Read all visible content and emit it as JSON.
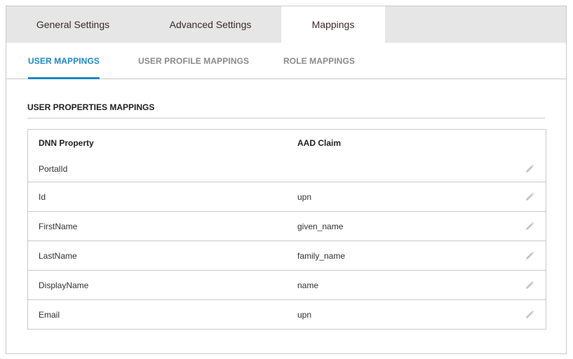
{
  "top_tabs": [
    {
      "label": "General Settings",
      "active": false
    },
    {
      "label": "Advanced Settings",
      "active": false
    },
    {
      "label": "Mappings",
      "active": true
    }
  ],
  "sub_tabs": [
    {
      "label": "USER MAPPINGS",
      "active": true
    },
    {
      "label": "USER PROFILE MAPPINGS",
      "active": false
    },
    {
      "label": "ROLE MAPPINGS",
      "active": false
    }
  ],
  "section": {
    "title": "USER PROPERTIES MAPPINGS"
  },
  "table": {
    "headers": {
      "property": "DNN Property",
      "claim": "AAD Claim"
    },
    "rows": [
      {
        "property": "PortalId",
        "claim": "",
        "action_icon": "pencil-icon"
      },
      {
        "property": "Id",
        "claim": "upn",
        "action_icon": "pencil-icon"
      },
      {
        "property": "FirstName",
        "claim": "given_name",
        "action_icon": "pencil-icon"
      },
      {
        "property": "LastName",
        "claim": "family_name",
        "action_icon": "pencil-icon"
      },
      {
        "property": "DisplayName",
        "claim": "name",
        "action_icon": "pencil-icon"
      },
      {
        "property": "Email",
        "claim": "upn",
        "action_icon": "pencil-icon"
      }
    ]
  },
  "colors": {
    "accent": "#1e88c7",
    "tab_bar_bg": "#e6e6e6",
    "border": "#c9c9c9",
    "inactive_subtab": "#8a8a8a"
  }
}
